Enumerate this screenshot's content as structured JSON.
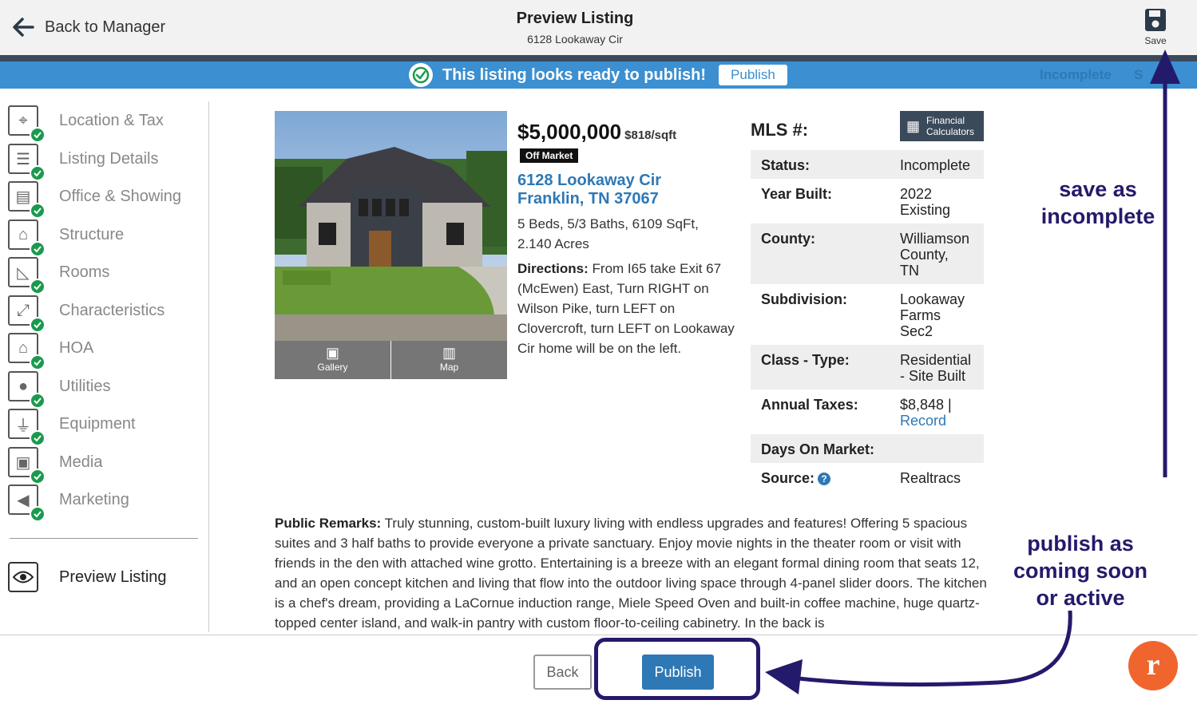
{
  "header": {
    "back_label": "Back to Manager",
    "title": "Preview Listing",
    "subtitle": "6128 Lookaway Cir",
    "save_label": "Save"
  },
  "banner": {
    "message": "This listing looks ready to publish!",
    "publish_label": "Publish",
    "status_left": "Incomplete",
    "status_right": "S"
  },
  "sidebar": {
    "items": [
      {
        "label": "Location & Tax",
        "icon": "map-pin-icon"
      },
      {
        "label": "Listing Details",
        "icon": "list-icon"
      },
      {
        "label": "Office & Showing",
        "icon": "briefcase-icon"
      },
      {
        "label": "Structure",
        "icon": "house-icon"
      },
      {
        "label": "Rooms",
        "icon": "ruler-icon"
      },
      {
        "label": "Characteristics",
        "icon": "expand-icon"
      },
      {
        "label": "HOA",
        "icon": "home-gear-icon"
      },
      {
        "label": "Utilities",
        "icon": "drop-icon"
      },
      {
        "label": "Equipment",
        "icon": "plug-icon"
      },
      {
        "label": "Media",
        "icon": "camera-icon"
      },
      {
        "label": "Marketing",
        "icon": "megaphone-icon"
      }
    ],
    "preview_label": "Preview Listing"
  },
  "listing": {
    "price": "$5,000,000",
    "price_per_sqft": "$818/sqft",
    "status_badge": "Off Market",
    "address_line1": "6128 Lookaway Cir",
    "address_line2": "Franklin, TN 37067",
    "specs": "5 Beds, 5/3 Baths, 6109 SqFt, 2.140 Acres",
    "directions_label": "Directions:",
    "directions": " From I65 take Exit 67 (McEwen) East, Turn RIGHT on Wilson Pike, turn LEFT on Clovercroft, turn LEFT on Lookaway Cir home will be on the left.",
    "gallery_label": "Gallery",
    "map_label": "Map",
    "mls_label": "MLS #:",
    "calc_line1": "Financial",
    "calc_line2": "Calculators",
    "facts": {
      "status_k": "Status:",
      "status_v": "Incomplete",
      "year_k": "Year Built:",
      "year_v1": "2022",
      "year_v2": "Existing",
      "county_k": "County:",
      "county_v1": "Williamson",
      "county_v2": "County,",
      "county_v3": "TN",
      "subdivision_k": "Subdivision:",
      "subdivision_v1": "Lookaway",
      "subdivision_v2": "Farms",
      "subdivision_v3": "Sec2",
      "class_k": "Class - Type:",
      "class_v1": "Residential",
      "class_v2": "- Site Built",
      "taxes_k": "Annual Taxes:",
      "taxes_v": "$8,848 |",
      "taxes_link": "Record",
      "dom_k": "Days On Market:",
      "source_k": "Source:",
      "source_v": "Realtracs"
    },
    "remarks_label": "Public Remarks:",
    "remarks": " Truly stunning, custom-built luxury living with endless upgrades and features! Offering 5 spacious suites and 3 half baths to provide everyone a private sanctuary. Enjoy movie nights in the theater room or visit with friends in the den with attached wine grotto. Entertaining is a breeze with an elegant formal dining room that seats 12, and an open concept kitchen and living that flow into the outdoor living space through 4-panel slider doors. The kitchen is a chef's dream, providing a LaCornue induction range, Miele Speed Oven and built-in coffee machine, huge quartz-topped center island, and walk-in pantry with custom floor-to-ceiling cabinetry. In the back is"
  },
  "footer": {
    "back_label": "Back",
    "publish_label": "Publish"
  },
  "annotations": {
    "save_note_1": "save as",
    "save_note_2": "incomplete",
    "publish_note_1": "publish as",
    "publish_note_2": "coming soon",
    "publish_note_3": "or active"
  },
  "colors": {
    "accent": "#2e78b5",
    "banner": "#3c8fd0",
    "success": "#1a9a4e",
    "annotation": "#241a6b",
    "logo": "#f0652d"
  }
}
